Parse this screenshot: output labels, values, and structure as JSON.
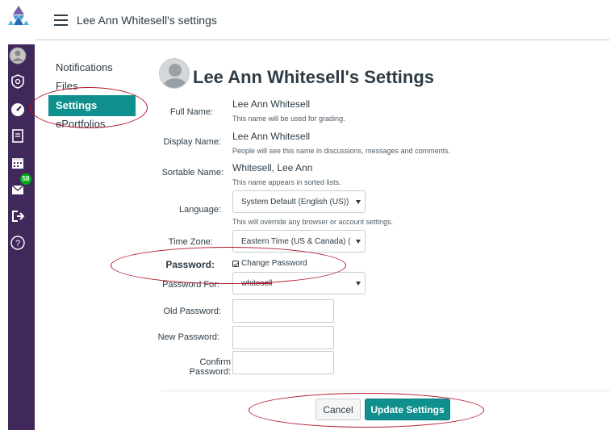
{
  "header": {
    "title": "Lee Ann Whitesell's settings"
  },
  "nav": {
    "badge_count": "58"
  },
  "subnav": {
    "items": [
      {
        "label": "Notifications"
      },
      {
        "label": "Files"
      },
      {
        "label": "Settings"
      },
      {
        "label": "ePortfolios"
      }
    ]
  },
  "page": {
    "title": "Lee Ann Whitesell's Settings"
  },
  "form": {
    "full_name": {
      "label": "Full Name:",
      "value": "Lee Ann Whitesell",
      "hint": "This name will be used for grading."
    },
    "display_name": {
      "label": "Display Name:",
      "value": "Lee Ann Whitesell",
      "hint": "People will see this name in discussions, messages and comments."
    },
    "sortable_name": {
      "label": "Sortable Name:",
      "value": "Whitesell, Lee Ann",
      "hint": "This name appears in sorted lists."
    },
    "language": {
      "label": "Language:",
      "value": "System Default (English (US))",
      "hint": "This will override any browser or account settings."
    },
    "time_zone": {
      "label": "Time Zone:",
      "value": "Eastern Time (US & Canada) ("
    },
    "password": {
      "label": "Password:",
      "checkbox_label": "Change Password"
    },
    "password_for": {
      "label": "Password For:",
      "value": "whitesell"
    },
    "old_password": {
      "label": "Old Password:"
    },
    "new_password": {
      "label": "New Password:"
    },
    "confirm_password": {
      "label": "Confirm Password:"
    }
  },
  "buttons": {
    "cancel": "Cancel",
    "update": "Update Settings"
  }
}
